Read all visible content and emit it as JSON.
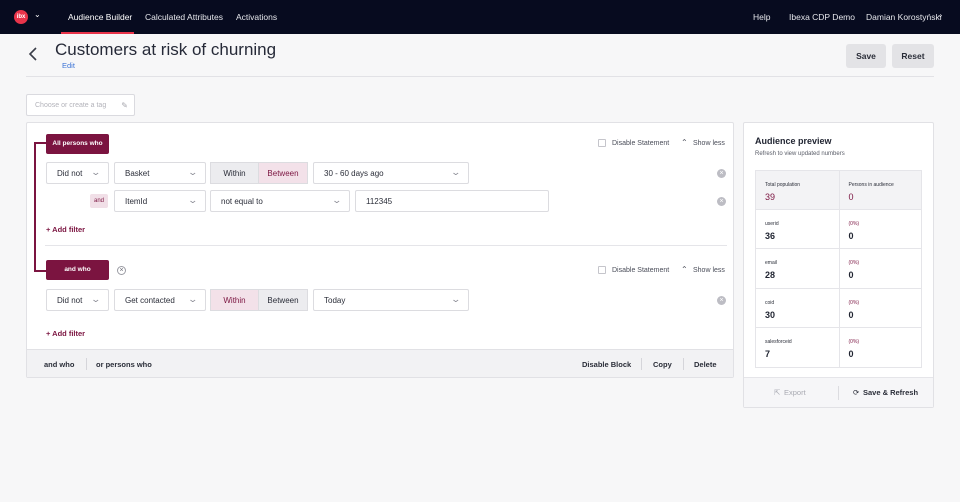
{
  "topbar": {
    "logo_text": "ibx",
    "nav": [
      "Audience Builder",
      "Calculated Attributes",
      "Activations"
    ],
    "right": [
      "Help",
      "Ibexa CDP Demo",
      "Damian Korostyński"
    ],
    "accent_color": "#e8344a"
  },
  "header": {
    "title": "Customers at risk of churning",
    "edit_label": "Edit",
    "save_label": "Save",
    "reset_label": "Reset"
  },
  "tag_input": {
    "placeholder": "Choose or create a tag"
  },
  "block1": {
    "label": "All persons who",
    "disable_label": "Disable Statement",
    "toggle_label": "Show less",
    "row1": {
      "negation": "Did not",
      "event": "Basket",
      "within": "Within",
      "between": "Between",
      "active_segment": "Between",
      "range": "30 - 60 days ago"
    },
    "row2": {
      "and_label": "and",
      "field": "ItemId",
      "operator": "not equal to",
      "value": "112345"
    },
    "add_filter": "+ Add filter"
  },
  "block2": {
    "label": "and who",
    "disable_label": "Disable Statement",
    "toggle_label": "Show less",
    "row1": {
      "negation": "Did not",
      "event": "Get contacted",
      "within": "Within",
      "between": "Between",
      "active_segment": "Within",
      "range": "Today"
    },
    "add_filter": "+ Add filter"
  },
  "footer": {
    "and_who": "and who",
    "or_persons": "or persons who",
    "disable_block": "Disable Block",
    "copy": "Copy",
    "delete": "Delete"
  },
  "preview": {
    "title": "Audience preview",
    "subtitle": "Refresh to view updated numbers",
    "total_label": "Total population",
    "total_value": "39",
    "in_audience_label": "Persons in audience",
    "in_audience_value": "0",
    "rows": [
      {
        "label": "userid",
        "value": "36",
        "pct": "(0%)",
        "count": "0"
      },
      {
        "label": "email",
        "value": "28",
        "pct": "(0%)",
        "count": "0"
      },
      {
        "label": "coid",
        "value": "30",
        "pct": "(0%)",
        "count": "0"
      },
      {
        "label": "salesforceid",
        "value": "7",
        "pct": "(0%)",
        "count": "0"
      }
    ],
    "export_label": "Export",
    "save_refresh_label": "Save & Refresh",
    "brand_color": "#7b1440"
  }
}
